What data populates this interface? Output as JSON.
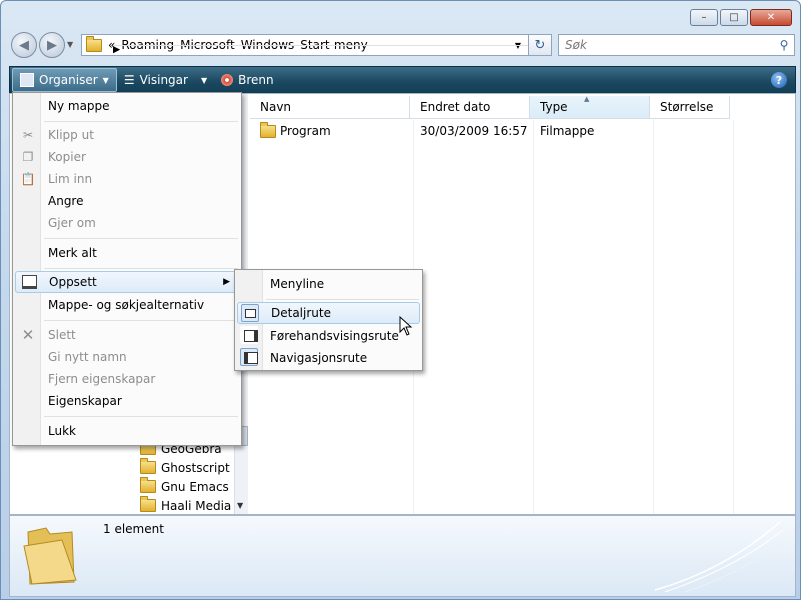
{
  "window": {
    "min_label": "–",
    "max_label": "□",
    "close_label": "✕"
  },
  "address": {
    "crumbs": [
      "«",
      "Roaming",
      "Microsoft",
      "Windows",
      "Start-meny"
    ],
    "separator": "▶"
  },
  "search": {
    "placeholder": "Søk"
  },
  "toolbar": {
    "organize": "Organiser",
    "views": "Visingar",
    "burn": "Brenn",
    "help": "?"
  },
  "columns": [
    "Navn",
    "Endret dato",
    "Type",
    "Størrelse"
  ],
  "files": [
    {
      "name": "Program",
      "date": "30/03/2009 16:57",
      "type": "Filmappe",
      "size": ""
    }
  ],
  "tree": [
    "GeoGebra",
    "Ghostscript",
    "Gnu Emacs",
    "Haali Media S"
  ],
  "organize_menu": {
    "items": [
      {
        "label": "Ny mappe",
        "disabled": false
      },
      {
        "label": "Klipp ut",
        "disabled": true,
        "icon": "scissors-icon"
      },
      {
        "label": "Kopier",
        "disabled": true,
        "icon": "copy-icon"
      },
      {
        "label": "Lim inn",
        "disabled": true,
        "icon": "paste-icon"
      },
      {
        "label": "Angre",
        "disabled": false
      },
      {
        "label": "Gjer om",
        "disabled": true
      },
      {
        "label": "Merk alt",
        "disabled": false
      },
      {
        "label": "Oppsett",
        "disabled": false,
        "icon": "layout-icon",
        "submenu": true
      },
      {
        "label": "Mappe- og søkjealternativ",
        "disabled": false
      },
      {
        "label": "Slett",
        "disabled": true,
        "icon": "delete-icon"
      },
      {
        "label": "Gi nytt namn",
        "disabled": true
      },
      {
        "label": "Fjern eigenskapar",
        "disabled": true
      },
      {
        "label": "Eigenskapar",
        "disabled": false
      },
      {
        "label": "Lukk",
        "disabled": false
      }
    ]
  },
  "layout_submenu": {
    "items": [
      {
        "label": "Menyline"
      },
      {
        "label": "Detaljrute",
        "checked": true
      },
      {
        "label": "Førehandsvisingsrute",
        "checked": false
      },
      {
        "label": "Navigasjonsrute",
        "checked": true
      }
    ]
  },
  "status": {
    "count": "1 element"
  }
}
